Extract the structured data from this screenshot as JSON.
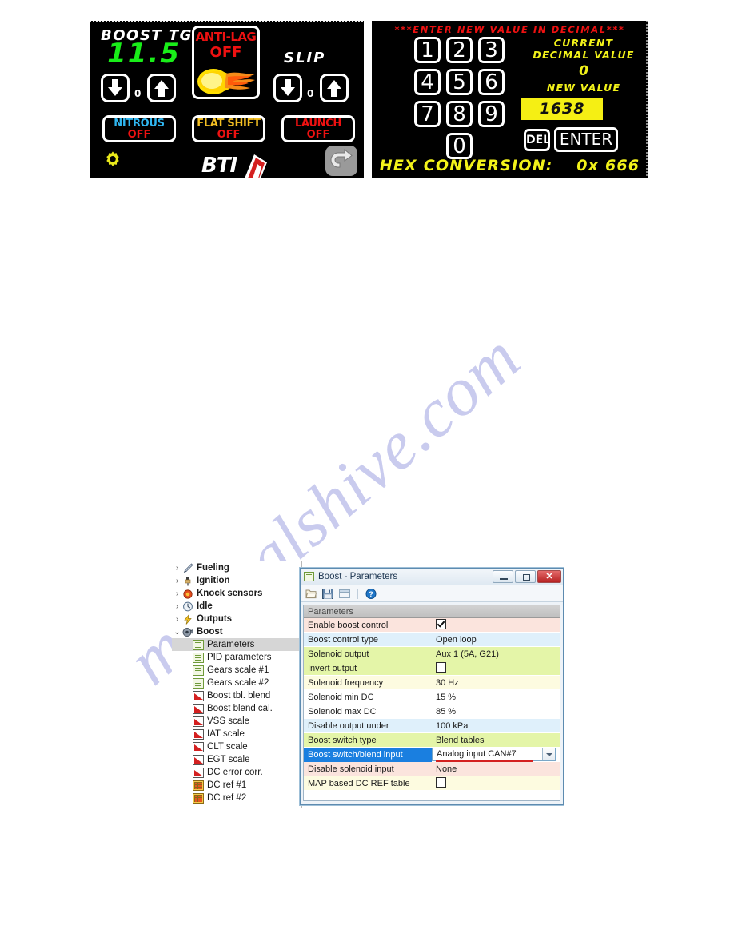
{
  "watermark": {
    "text": "manualshive.com"
  },
  "dash_panel": {
    "boost": {
      "label": "BOOST TGT",
      "value": "11.5",
      "step": "0",
      "down_icon": "arrow-down-icon",
      "up_icon": "arrow-up-icon"
    },
    "anti_lag": {
      "title": "ANTI-LAG",
      "state": "OFF",
      "icon": "flame-icon"
    },
    "slip": {
      "label": "SLIP",
      "step": "0",
      "down_icon": "arrow-down-icon",
      "up_icon": "arrow-up-icon"
    },
    "buttons": [
      {
        "title": "NITROUS",
        "state": "OFF",
        "title_color": "#2fb6f0"
      },
      {
        "title": "FLAT SHIFT",
        "state": "OFF",
        "title_color": "#f5c022"
      },
      {
        "title": "LAUNCH",
        "state": "OFF",
        "title_color": "#ee1111"
      }
    ],
    "footer": {
      "settings_icon": "gear-icon",
      "logo_text": "BTI",
      "back_icon": "back-arrow-icon"
    }
  },
  "keypad_panel": {
    "header": "***ENTER NEW VALUE IN DECIMAL***",
    "keys": [
      "1",
      "2",
      "3",
      "4",
      "5",
      "6",
      "7",
      "8",
      "9",
      "0"
    ],
    "current_decimal_label": "CURRENT DECIMAL VALUE",
    "current_decimal_value": "0",
    "new_value_label": "NEW VALUE",
    "new_value": "1638",
    "delete_label": "DEL",
    "enter_label": "ENTER",
    "hex_conversion_label": "HEX CONVERSION:",
    "hex_conversion_value": "0x 666"
  },
  "tree": {
    "items": [
      {
        "label": "Fueling",
        "level": 0,
        "expander": "›",
        "icon": "fueling-icon",
        "icon_class": "ic-fuel",
        "selected": false,
        "group": true
      },
      {
        "label": "Ignition",
        "level": 0,
        "expander": "›",
        "icon": "ignition-icon",
        "icon_class": "ic-generic",
        "selected": false,
        "group": true
      },
      {
        "label": "Knock sensors",
        "level": 0,
        "expander": "›",
        "icon": "knock-sensor-icon",
        "icon_class": "ic-generic",
        "selected": false,
        "group": true
      },
      {
        "label": "Idle",
        "level": 0,
        "expander": "›",
        "icon": "idle-icon",
        "icon_class": "ic-generic",
        "selected": false,
        "group": true
      },
      {
        "label": "Outputs",
        "level": 0,
        "expander": "›",
        "icon": "outputs-icon",
        "icon_class": "ic-generic",
        "selected": false,
        "group": true
      },
      {
        "label": "Boost",
        "level": 0,
        "expander": "⌄",
        "icon": "turbo-icon",
        "icon_class": "ic-generic",
        "selected": false,
        "group": true
      },
      {
        "label": "Parameters",
        "level": 1,
        "expander": "",
        "icon": "document-icon",
        "icon_class": "ic-doc",
        "selected": true,
        "group": false
      },
      {
        "label": "PID parameters",
        "level": 1,
        "expander": "",
        "icon": "document-icon",
        "icon_class": "ic-doc",
        "selected": false,
        "group": false
      },
      {
        "label": "Gears scale #1",
        "level": 1,
        "expander": "",
        "icon": "document-icon",
        "icon_class": "ic-doc",
        "selected": false,
        "group": false
      },
      {
        "label": "Gears scale #2",
        "level": 1,
        "expander": "",
        "icon": "document-icon",
        "icon_class": "ic-doc",
        "selected": false,
        "group": false
      },
      {
        "label": "Boost tbl. blend",
        "level": 1,
        "expander": "",
        "icon": "chart-icon",
        "icon_class": "ic-chart",
        "selected": false,
        "group": false
      },
      {
        "label": "Boost blend cal.",
        "level": 1,
        "expander": "",
        "icon": "chart-icon",
        "icon_class": "ic-chart",
        "selected": false,
        "group": false
      },
      {
        "label": "VSS scale",
        "level": 1,
        "expander": "",
        "icon": "chart-icon",
        "icon_class": "ic-chart",
        "selected": false,
        "group": false
      },
      {
        "label": "IAT scale",
        "level": 1,
        "expander": "",
        "icon": "chart-icon",
        "icon_class": "ic-chart",
        "selected": false,
        "group": false
      },
      {
        "label": "CLT scale",
        "level": 1,
        "expander": "",
        "icon": "chart-icon",
        "icon_class": "ic-chart",
        "selected": false,
        "group": false
      },
      {
        "label": "EGT scale",
        "level": 1,
        "expander": "",
        "icon": "chart-icon",
        "icon_class": "ic-chart",
        "selected": false,
        "group": false
      },
      {
        "label": "DC error corr.",
        "level": 1,
        "expander": "",
        "icon": "chart-icon",
        "icon_class": "ic-chart",
        "selected": false,
        "group": false
      },
      {
        "label": "DC ref #1",
        "level": 1,
        "expander": "",
        "icon": "table-icon",
        "icon_class": "ic-table",
        "selected": false,
        "group": false
      },
      {
        "label": "DC ref #2",
        "level": 1,
        "expander": "",
        "icon": "table-icon",
        "icon_class": "ic-table",
        "selected": false,
        "group": false
      }
    ]
  },
  "dialog": {
    "title": "Boost - Parameters",
    "title_icon": "document-icon",
    "window_buttons": {
      "minimize": "minimize-icon",
      "maximize": "maximize-icon",
      "close": "✕"
    },
    "toolbar": [
      {
        "name": "open-icon"
      },
      {
        "name": "save-icon"
      },
      {
        "name": "window-icon"
      },
      {
        "name": "help-icon"
      }
    ],
    "grid_header": "Parameters",
    "rows": [
      {
        "name": "Enable boost control",
        "value": "",
        "type": "checkbox",
        "checked": true,
        "bg": "#fbe4dd",
        "selected": false
      },
      {
        "name": "Boost control type",
        "value": "Open loop",
        "type": "text",
        "checked": false,
        "bg": "#dff0fb",
        "selected": false
      },
      {
        "name": "Solenoid output",
        "value": "Aux 1 (5A, G21)",
        "type": "text",
        "checked": false,
        "bg": "#e4f5a8",
        "selected": false
      },
      {
        "name": "Invert output",
        "value": "",
        "type": "checkbox",
        "checked": false,
        "bg": "#e4f5a8",
        "selected": false
      },
      {
        "name": "Solenoid frequency",
        "value": "30 Hz",
        "type": "text",
        "checked": false,
        "bg": "#fdfbe0",
        "selected": false
      },
      {
        "name": "Solenoid min DC",
        "value": "15 %",
        "type": "text",
        "checked": false,
        "bg": "#ffffff",
        "selected": false
      },
      {
        "name": "Solenoid max DC",
        "value": "85 %",
        "type": "text",
        "checked": false,
        "bg": "#ffffff",
        "selected": false
      },
      {
        "name": "Disable output under",
        "value": "100 kPa",
        "type": "text",
        "checked": false,
        "bg": "#dff0fb",
        "selected": false
      },
      {
        "name": "Boost switch type",
        "value": "Blend tables",
        "type": "text",
        "checked": false,
        "bg": "#e4f5a8",
        "selected": false
      },
      {
        "name": "Boost switch/blend input",
        "value": "Analog input CAN#7",
        "type": "combo",
        "checked": false,
        "bg": "#ffffff",
        "selected": true
      },
      {
        "name": "Disable solenoid input",
        "value": "None",
        "type": "text",
        "checked": false,
        "bg": "#fbe4dd",
        "selected": false
      },
      {
        "name": "MAP based DC REF table",
        "value": "",
        "type": "checkbox",
        "checked": false,
        "bg": "#fdfbe0",
        "selected": false
      }
    ]
  }
}
